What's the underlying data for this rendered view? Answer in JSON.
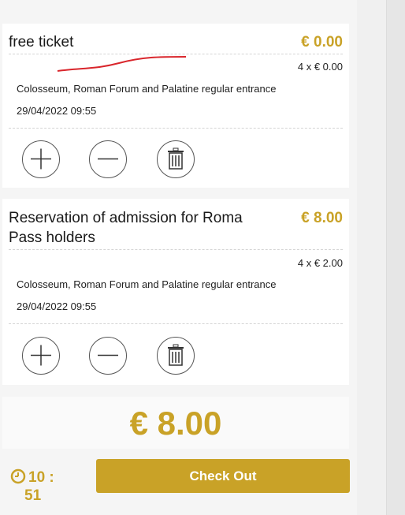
{
  "cart": {
    "items": [
      {
        "title": "free ticket",
        "price": "€ 0.00",
        "quantity_text": "4 x € 0.00",
        "description": "Colosseum, Roman Forum and Palatine regular entrance",
        "datetime": "29/04/2022 09:55",
        "icons": [
          "plus-icon",
          "minus-icon",
          "trash-icon"
        ]
      },
      {
        "title_line1": "Reservation of admission for Roma",
        "title_line2": "Pass holders",
        "price": "€ 8.00",
        "quantity_text": "4 x € 2.00",
        "description": "Colosseum, Roman Forum and Palatine regular entrance",
        "datetime": "29/04/2022 09:55",
        "icons": [
          "plus-icon",
          "minus-icon",
          "trash-icon"
        ]
      }
    ],
    "total": "€ 8.00"
  },
  "timer": {
    "icon": "clock-icon",
    "line1": "10 :",
    "line2": "51"
  },
  "checkout": {
    "label": "Check Out"
  },
  "colors": {
    "accent": "#c9a227",
    "annotation": "#d9262c"
  }
}
